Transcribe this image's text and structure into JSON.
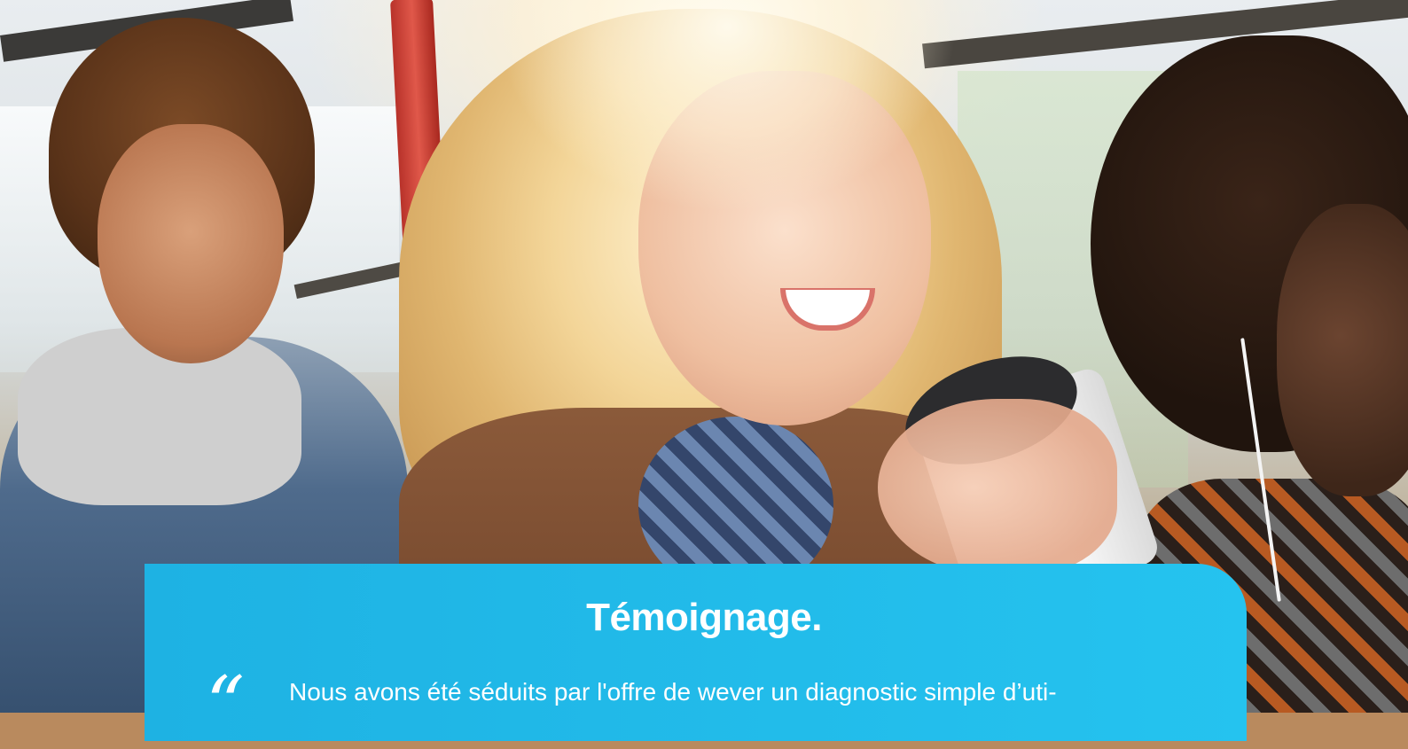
{
  "hero": {
    "image_alt": "Passengers smiling on a bus"
  },
  "testimonial": {
    "title": "Témoignage.",
    "quote_mark": "“",
    "text": "Nous avons été séduits par l'offre de wever un diagnostic simple d’uti-"
  },
  "colors": {
    "card_accent": "#25c3ef",
    "text": "#ffffff"
  }
}
